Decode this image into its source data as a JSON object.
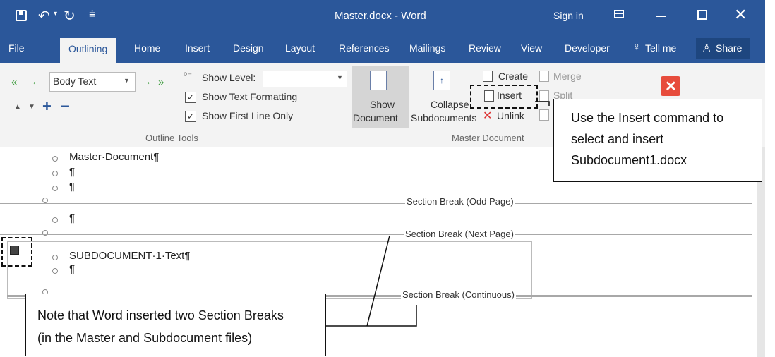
{
  "window": {
    "title": "Master.docx  -  Word",
    "sign_in": "Sign in"
  },
  "tabs": [
    "File",
    "Outlining",
    "Home",
    "Insert",
    "Design",
    "Layout",
    "References",
    "Mailings",
    "Review",
    "View",
    "Developer",
    "Tell me",
    "Share"
  ],
  "outline_tools": {
    "style_value": "Body Text",
    "show_level_label": "Show Level:",
    "show_text_formatting": "Show Text Formatting",
    "show_first_line_only": "Show First Line Only",
    "group_label": "Outline Tools"
  },
  "master_document": {
    "show_document_1": "Show",
    "show_document_2": "Document",
    "collapse_1": "Collapse",
    "collapse_2": "Subdocuments",
    "create": "Create",
    "insert": "Insert",
    "unlink": "Unlink",
    "merge": "Merge",
    "split": "Split",
    "group_label": "Master Document"
  },
  "document": {
    "line1": "Master·Document¶",
    "pilcrow": "¶",
    "section_break_odd": "Section Break (Odd Page)",
    "section_break_next": "Section Break (Next Page)",
    "subdoc_text": "SUBDOCUMENT·1·Text¶",
    "section_break_continuous": "Section Break (Continuous)"
  },
  "callouts": {
    "insert_note": [
      "Use the Insert command to",
      "select and insert",
      "Subdocument1.docx"
    ],
    "sections_note": [
      "Note that Word inserted two Section Breaks",
      "(in the Master and Subdocument files)"
    ]
  },
  "colors": {
    "word_blue": "#2b579a",
    "close_red": "#e74c3c"
  }
}
